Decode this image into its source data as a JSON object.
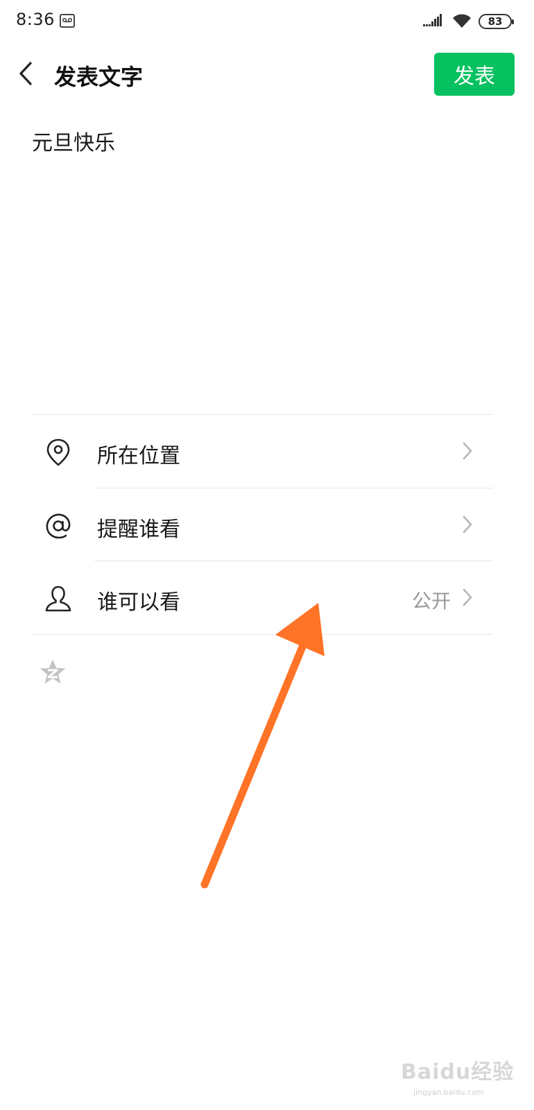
{
  "status_bar": {
    "time": "8:36",
    "battery": "83"
  },
  "header": {
    "back_icon": "chevron-left-icon",
    "title": "发表文字",
    "publish_label": "发表"
  },
  "post": {
    "text": "元旦快乐"
  },
  "options": [
    {
      "icon": "location-pin-icon",
      "label": "所在位置",
      "value": ""
    },
    {
      "icon": "at-sign-icon",
      "label": "提醒谁看",
      "value": ""
    },
    {
      "icon": "person-icon",
      "label": "谁可以看",
      "value": "公开"
    }
  ],
  "share_icon": "qzone-icon",
  "colors": {
    "accent": "#07c160",
    "annotation_arrow": "#ff7327",
    "secondary_text": "#9a9a9a"
  },
  "watermark": {
    "text": "Baidu经验",
    "subtext": "jingyan.baidu.com"
  }
}
